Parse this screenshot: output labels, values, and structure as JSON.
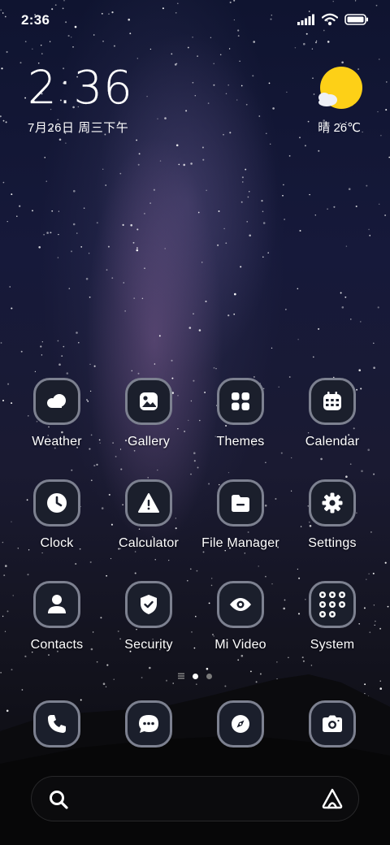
{
  "status_bar": {
    "time": "2:36",
    "icons": [
      "signal-icon",
      "wifi-icon",
      "battery-icon"
    ]
  },
  "clock_widget": {
    "time": "2:36",
    "date": "7月26日 周三下午"
  },
  "weather_widget": {
    "text": "晴 26℃",
    "icon": "sun-cloud-icon",
    "sun_color": "#fdd017"
  },
  "apps": [
    {
      "label": "Weather",
      "icon": "weather-cloud-icon"
    },
    {
      "label": "Gallery",
      "icon": "gallery-icon"
    },
    {
      "label": "Themes",
      "icon": "themes-grid-icon"
    },
    {
      "label": "Calendar",
      "icon": "calendar-icon"
    },
    {
      "label": "Clock",
      "icon": "clock-icon"
    },
    {
      "label": "Calculator",
      "icon": "warning-triangle-icon"
    },
    {
      "label": "File Manager",
      "icon": "folder-icon"
    },
    {
      "label": "Settings",
      "icon": "gear-icon"
    },
    {
      "label": "Contacts",
      "icon": "contact-person-icon"
    },
    {
      "label": "Security",
      "icon": "shield-check-icon"
    },
    {
      "label": "Mi Video",
      "icon": "eye-icon"
    },
    {
      "label": "System",
      "icon": "folder-grid-icon"
    }
  ],
  "page_indicator": {
    "pages": 3,
    "active_index": 1
  },
  "dock": [
    {
      "icon": "phone-icon"
    },
    {
      "icon": "message-icon"
    },
    {
      "icon": "compass-icon"
    },
    {
      "icon": "camera-icon"
    }
  ],
  "search_bar": {
    "left_icon": "search-icon",
    "right_icon": "assistant-a-icon"
  },
  "colors": {
    "icon_bg": "#1b1f2c",
    "icon_border": "#7d8190",
    "sky": "#16193a"
  }
}
